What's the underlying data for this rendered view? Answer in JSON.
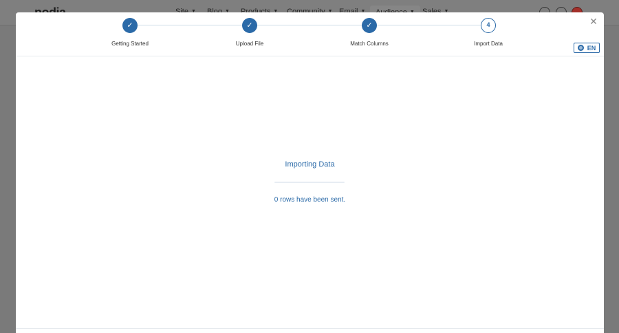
{
  "background_app": {
    "logo": "podia",
    "menu": [
      {
        "label": "Site"
      },
      {
        "label": "Blog"
      },
      {
        "label": "Products"
      },
      {
        "label": "Community"
      },
      {
        "label": "Email"
      },
      {
        "label": "Audience",
        "active": true
      },
      {
        "label": "Sales"
      }
    ],
    "caret": "▼",
    "icons": [
      "search-icon",
      "help-icon",
      "avatar"
    ]
  },
  "modal": {
    "close_glyph": "✕",
    "steps": [
      {
        "label": "Getting Started",
        "status": "done",
        "glyph": "✓"
      },
      {
        "label": "Upload File",
        "status": "done",
        "glyph": "✓"
      },
      {
        "label": "Match Columns",
        "status": "done",
        "glyph": "✓"
      },
      {
        "label": "Import Data",
        "status": "current",
        "glyph": "4"
      }
    ],
    "language": "EN",
    "import_title": "Importing Data",
    "progress_fraction": 0,
    "rows_sent_text": "0 rows have been sent."
  },
  "colors": {
    "accent": "#2b6aa8",
    "overlay": "#7a7a7a"
  }
}
